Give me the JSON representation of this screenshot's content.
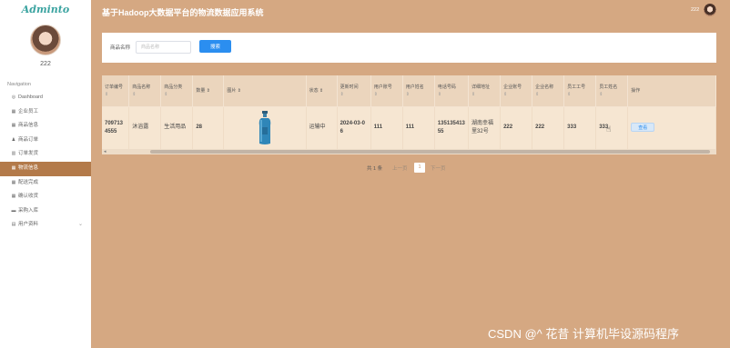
{
  "app": {
    "brand": "Adminto",
    "title": "基于Hadoop大数据平台的物流数据应用系统"
  },
  "user": {
    "name": "222"
  },
  "sidebar": {
    "section_title": "Navigation",
    "items": [
      {
        "label": "Dashboard",
        "icon": "dashboard-icon",
        "glyph": "◎"
      },
      {
        "label": "企业员工",
        "icon": "grid-icon",
        "glyph": "▦"
      },
      {
        "label": "商品信息",
        "icon": "grid-icon",
        "glyph": "▦"
      },
      {
        "label": "商品订单",
        "icon": "person-icon",
        "glyph": "♟"
      },
      {
        "label": "订单发货",
        "icon": "chart-icon",
        "glyph": "▥"
      },
      {
        "label": "物流信息",
        "icon": "grid-icon",
        "glyph": "▦"
      },
      {
        "label": "配送完成",
        "icon": "grid-icon",
        "glyph": "▦"
      },
      {
        "label": "确认收货",
        "icon": "grid-icon",
        "glyph": "▦"
      },
      {
        "label": "采购入库",
        "icon": "box-icon",
        "glyph": "▬"
      },
      {
        "label": "用户资料",
        "icon": "profile-icon",
        "glyph": "▤"
      }
    ]
  },
  "search": {
    "label": "商品名称",
    "placeholder": "商品名称",
    "value": "",
    "button_label": "搜索"
  },
  "table": {
    "columns": [
      "订单编号",
      "商品名称",
      "商品分类",
      "数量",
      "图片",
      "状态",
      "更新时间",
      "用户账号",
      "用户姓名",
      "电话号码",
      "详细地址",
      "企业账号",
      "企业名称",
      "员工工号",
      "员工姓名",
      "操作"
    ],
    "rows": [
      {
        "order_no": "7097134555",
        "product_name": "沐浴露",
        "category": "生活用品",
        "quantity": "28",
        "image": "shampoo-bottle-image",
        "status": "运输中",
        "updated_at": "2024-03-06",
        "user_account": "111",
        "user_name": "111",
        "phone": "13513541355",
        "address": "湖南幸福里32号",
        "company_account": "222",
        "company_name": "222",
        "staff_no": "333",
        "staff_name": "333",
        "action_label": "查看"
      }
    ]
  },
  "pagination": {
    "total": "共 1 条",
    "prev": "上一页",
    "page": "1",
    "next": "下一页"
  },
  "watermark": "CSDN @^ 花昔  计算机毕设源码程序",
  "colors": {
    "background": "#d5a882",
    "sidebar_active": "#b37a4a",
    "primary": "#2b8ef0",
    "brand": "#3aa3a0"
  }
}
